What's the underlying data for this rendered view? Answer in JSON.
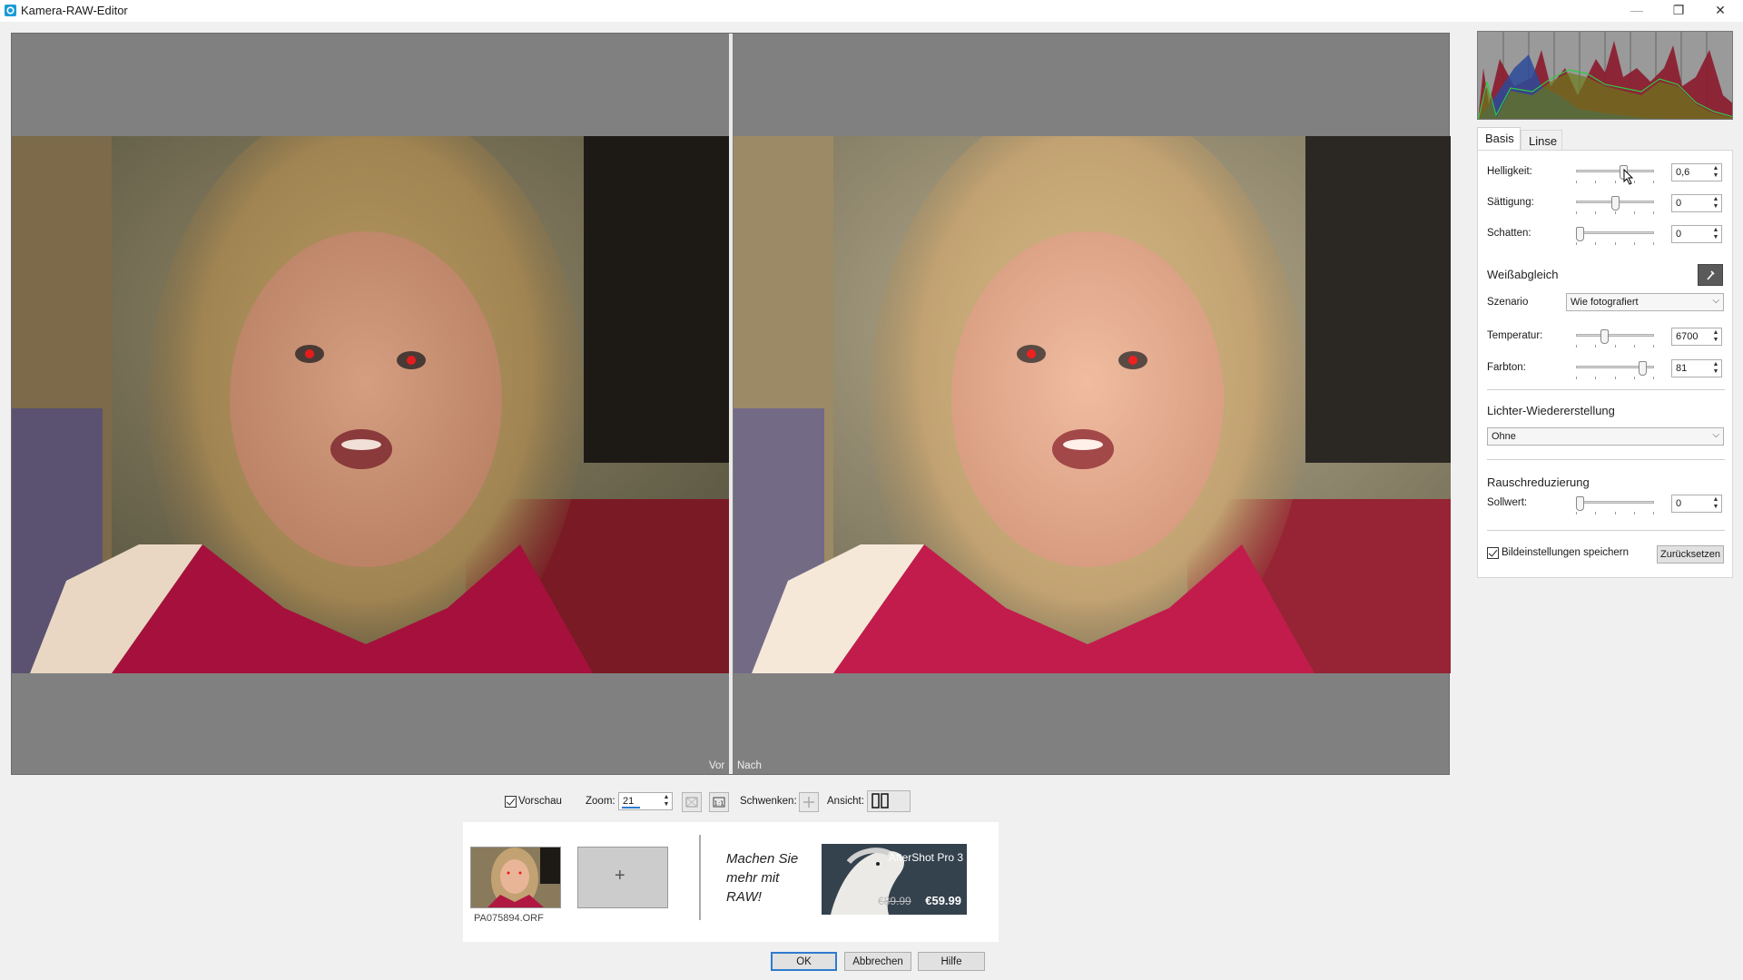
{
  "window": {
    "title": "Kamera-RAW-Editor",
    "minimize": "—",
    "maximize": "❐",
    "close": "✕"
  },
  "preview": {
    "before_label": "Vor",
    "after_label": "Nach"
  },
  "toolbar": {
    "preview_label": "Vorschau",
    "zoom_label": "Zoom:",
    "zoom_value": "21",
    "pan_label": "Schwenken:",
    "view_label": "Ansicht:"
  },
  "strip": {
    "file_name": "PA075894.ORF",
    "add_label": "+",
    "promo_text": "Machen Sie mehr mit RAW!",
    "product_name": "AfterShot Pro 3",
    "old_price": "€89.99",
    "new_price": "€59.99"
  },
  "buttons": {
    "ok": "OK",
    "cancel": "Abbrechen",
    "help": "Hilfe"
  },
  "tabs": [
    {
      "label": "Basis"
    },
    {
      "label": "Linse"
    }
  ],
  "basic": {
    "brightness_label": "Helligkeit:",
    "brightness_value": "0,6",
    "saturation_label": "Sättigung:",
    "saturation_value": "0",
    "shadows_label": "Schatten:",
    "shadows_value": "0"
  },
  "white_balance": {
    "title": "Weißabgleich",
    "scenario_label": "Szenario",
    "scenario_value": "Wie fotografiert",
    "temperature_label": "Temperatur:",
    "temperature_value": "6700",
    "tint_label": "Farbton:",
    "tint_value": "81"
  },
  "highlight": {
    "title": "Lichter-Wiedererstellung",
    "value": "Ohne"
  },
  "noise": {
    "title": "Rauschreduzierung",
    "amount_label": "Sollwert:",
    "amount_value": "0"
  },
  "footer": {
    "save_label": "Bildeinstellungen speichern",
    "reset_label": "Zurücksetzen"
  }
}
